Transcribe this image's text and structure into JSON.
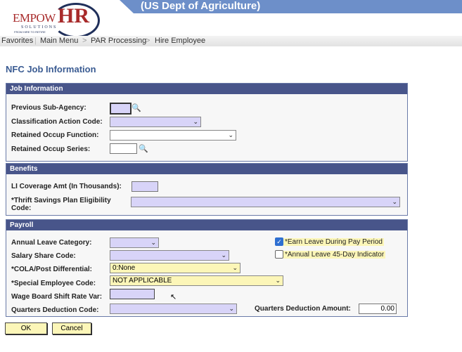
{
  "header": {
    "org": "(US Dept of Agriculture)",
    "logo": {
      "brand": "EMPOW",
      "brand2": "HR",
      "sub": "SOLUTIONS",
      "tagline": "FROM HIRE TO RETIRE"
    }
  },
  "nav": {
    "items": [
      "Favorites",
      "Main Menu",
      "PAR Processing",
      "Hire Employee"
    ],
    "separator": ">"
  },
  "page_title": "NFC Job Information",
  "job_info": {
    "title": "Job Information",
    "prev_sub_agency": {
      "label": "Previous Sub-Agency:",
      "value": ""
    },
    "class_action": {
      "label": "Classification Action Code:",
      "value": ""
    },
    "retained_function": {
      "label": "Retained Occup Function:",
      "value": ""
    },
    "retained_series": {
      "label": "Retained Occup Series:",
      "value": ""
    }
  },
  "benefits": {
    "title": "Benefits",
    "li_coverage": {
      "label": "LI Coverage Amt (In Thousands):",
      "value": ""
    },
    "tsp": {
      "label": "*Thrift Savings Plan Eligibility Code:",
      "value": ""
    }
  },
  "payroll": {
    "title": "Payroll",
    "annual_leave": {
      "label": "Annual Leave Category:",
      "value": ""
    },
    "salary_share": {
      "label": "Salary Share Code:",
      "value": ""
    },
    "cola": {
      "label": "*COLA/Post Differential:",
      "value": "0:None"
    },
    "special": {
      "label": "*Special Employee Code:",
      "value": "NOT APPLICABLE"
    },
    "wage_board": {
      "label": "Wage Board Shift Rate Var:",
      "value": ""
    },
    "quarters_code": {
      "label": "Quarters Deduction Code:",
      "value": ""
    },
    "quarters_amount": {
      "label": "Quarters Deduction Amount:",
      "value": "0.00"
    },
    "earn_leave": {
      "label": "*Earn Leave During Pay Period",
      "checked": true
    },
    "al45": {
      "label": "*Annual Leave 45-Day Indicator",
      "checked": false
    }
  },
  "buttons": {
    "ok": "OK",
    "cancel": "Cancel"
  },
  "colors": {
    "section_header": "#48558a",
    "required_field": "#fcf6b8",
    "optional_field": "#d8d4f8",
    "title": "#3a5b92"
  }
}
